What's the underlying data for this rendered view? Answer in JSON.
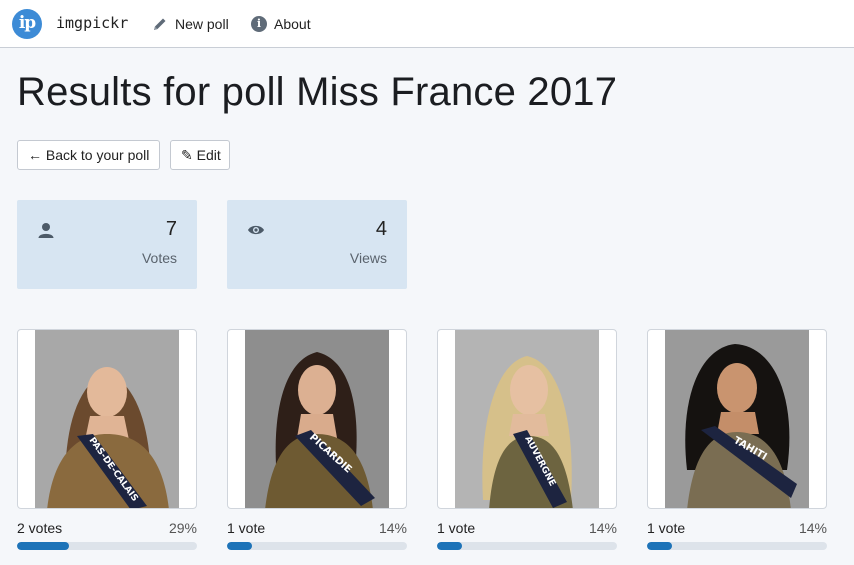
{
  "nav": {
    "logo_text": "ip",
    "brand": "imgpickr",
    "new_poll": "New poll",
    "about": "About"
  },
  "page": {
    "title": "Results for poll Miss France 2017"
  },
  "actions": {
    "back": "← Back to your poll",
    "edit": "✎ Edit"
  },
  "stats": {
    "votes": {
      "value": "7",
      "label": "Votes",
      "icon": "user-icon"
    },
    "views": {
      "value": "4",
      "label": "Views",
      "icon": "eye-icon"
    }
  },
  "results": [
    {
      "votes_text": "2 votes",
      "percent_text": "29%",
      "fraction": 0.29,
      "sash_text": "PAS-DE-CALAIS",
      "bg": "#a8a8a8",
      "dress": "#8a6a3e",
      "hair": "#6b4a2e"
    },
    {
      "votes_text": "1 vote",
      "percent_text": "14%",
      "fraction": 0.14,
      "sash_text": "PICARDIE",
      "bg": "#8e8e8e",
      "dress": "#6e5a32",
      "hair": "#2e1f18"
    },
    {
      "votes_text": "1 vote",
      "percent_text": "14%",
      "fraction": 0.14,
      "sash_text": "AUVERGNE",
      "bg": "#b4b4b4",
      "dress": "#6d6440",
      "hair": "#d6c08a"
    },
    {
      "votes_text": "1 vote",
      "percent_text": "14%",
      "fraction": 0.14,
      "sash_text": "TAHITI",
      "bg": "#9a9a9a",
      "dress": "#7a6d52",
      "hair": "#151210"
    }
  ],
  "colors": {
    "accent": "#1d73b8",
    "stat_bg": "#d7e5f2",
    "logo_bg": "#3d8bd6"
  }
}
